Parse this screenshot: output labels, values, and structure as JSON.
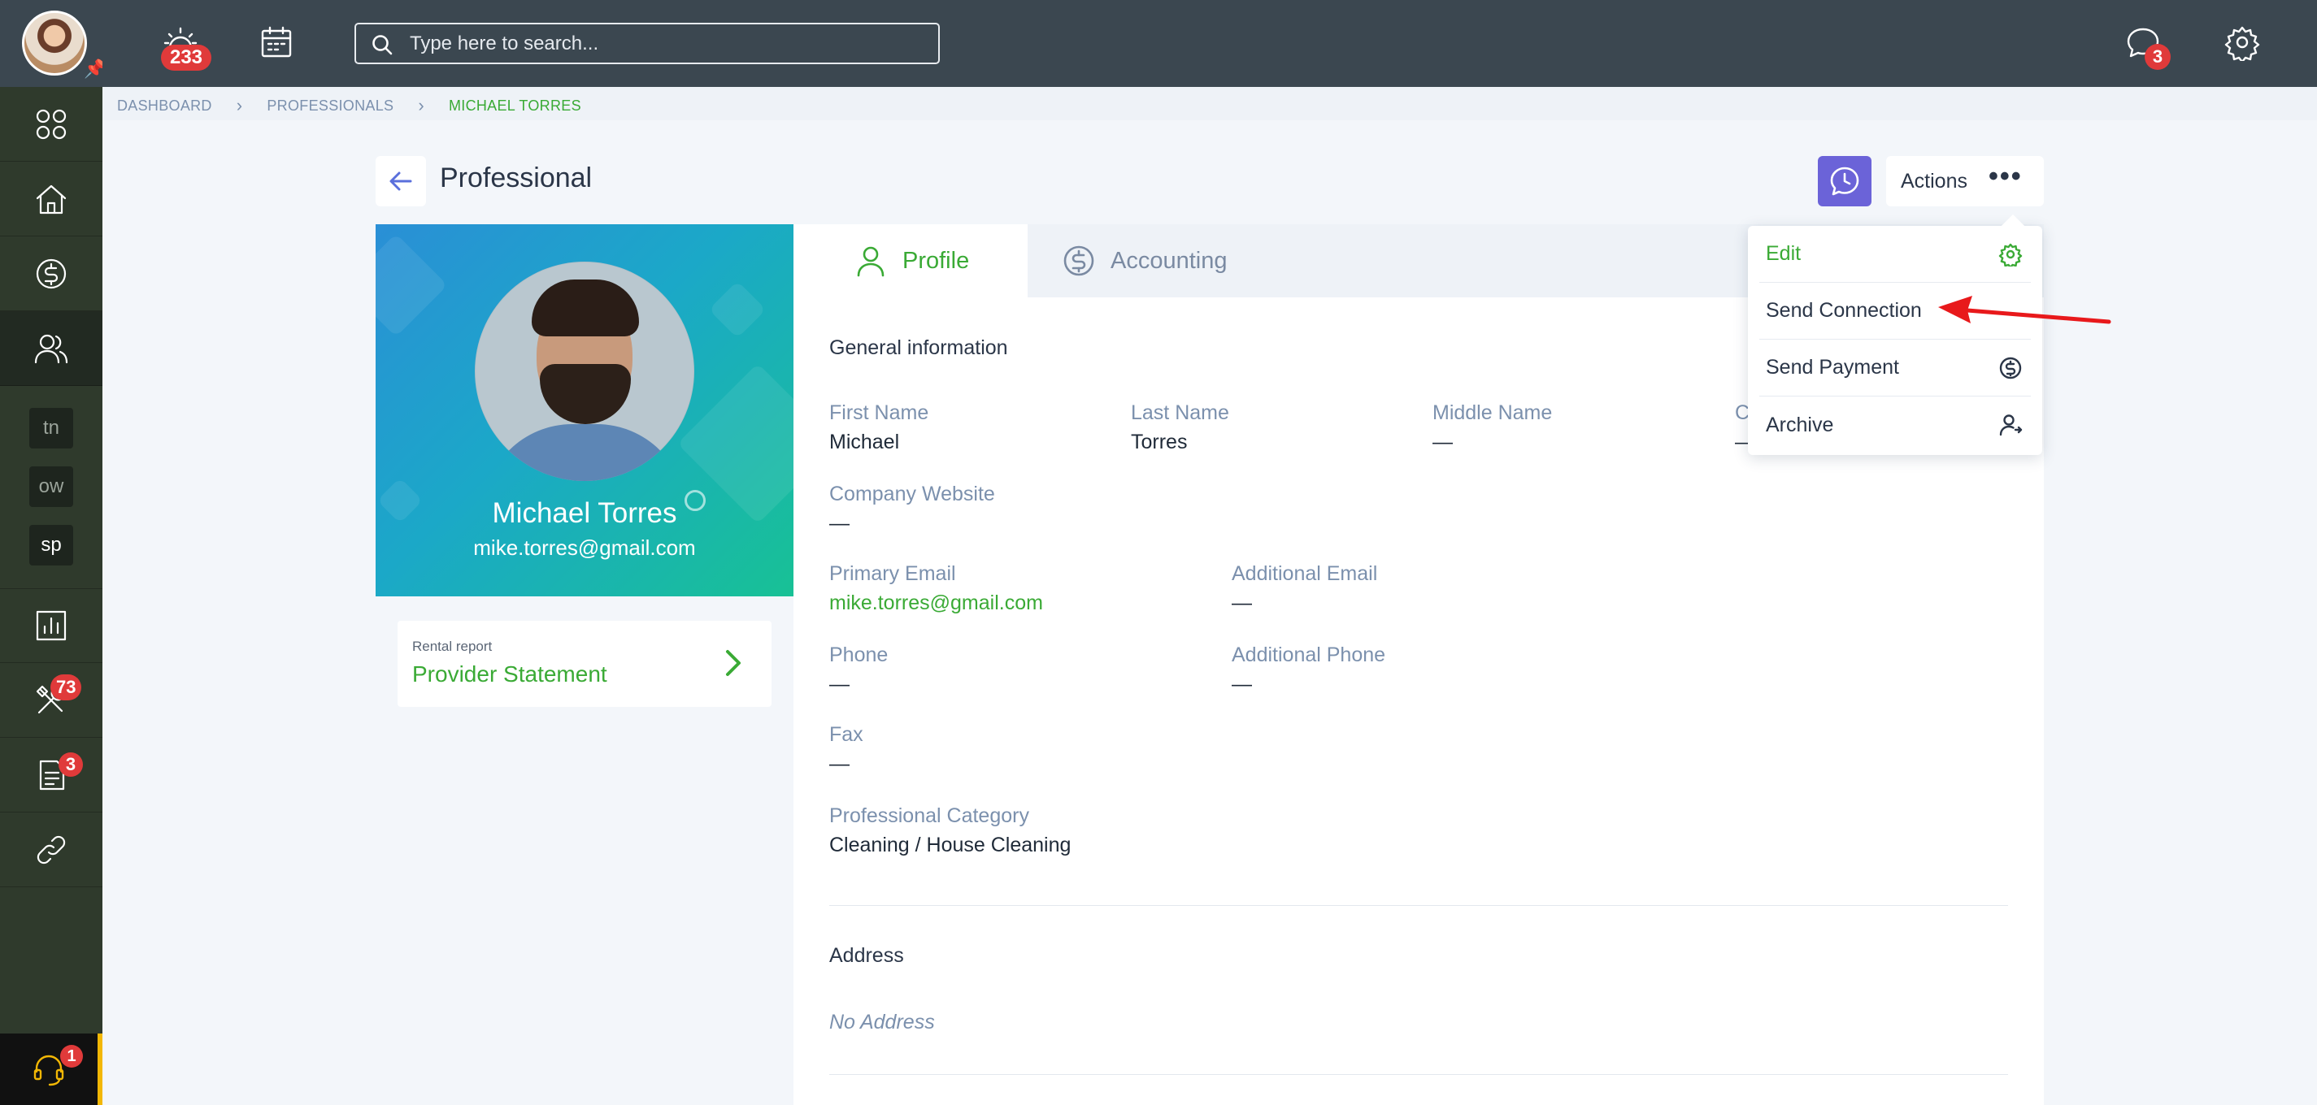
{
  "topbar": {
    "alerts_badge": "233",
    "search_placeholder": "Type here to search...",
    "chat_badge": "3"
  },
  "sidebar": {
    "abbr_items": [
      "tn",
      "ow",
      "sp"
    ],
    "tools_badge": "73",
    "reports_badge": "3",
    "support_badge": "1"
  },
  "breadcrumb": {
    "items": [
      "DASHBOARD",
      "PROFESSIONALS",
      "MICHAEL TORRES"
    ]
  },
  "page": {
    "title": "Professional",
    "actions_label": "Actions"
  },
  "profile": {
    "name": "Michael Torres",
    "email": "mike.torres@gmail.com",
    "report_small": "Rental report",
    "report_big": "Provider Statement"
  },
  "tabs": [
    {
      "label": "Profile"
    },
    {
      "label": "Accounting"
    }
  ],
  "general": {
    "title": "General information",
    "first_name_label": "First Name",
    "first_name": "Michael",
    "last_name_label": "Last Name",
    "last_name": "Torres",
    "middle_name_label": "Middle Name",
    "middle_name": "—",
    "fourth_label": "C",
    "fourth_value": "—",
    "website_label": "Company Website",
    "website": "—",
    "primary_email_label": "Primary Email",
    "primary_email": "mike.torres@gmail.com",
    "additional_email_label": "Additional Email",
    "additional_email": "—",
    "phone_label": "Phone",
    "phone": "—",
    "additional_phone_label": "Additional Phone",
    "additional_phone": "—",
    "fax_label": "Fax",
    "fax": "—",
    "category_label": "Professional Category",
    "category": "Cleaning / House Cleaning"
  },
  "address": {
    "title": "Address",
    "value": "No Address"
  },
  "dropdown": {
    "items": [
      {
        "label": "Edit",
        "icon": "gear-icon"
      },
      {
        "label": "Send Connection",
        "icon": ""
      },
      {
        "label": "Send Payment",
        "icon": "dollar-circle-icon"
      },
      {
        "label": "Archive",
        "icon": "user-archive-icon"
      }
    ]
  },
  "colors": {
    "accent_green": "#3aaa35",
    "topbar": "#3b4750",
    "sidebar": "#2f3a2c",
    "history_button": "#6b63d8",
    "badge_red": "#e03a3a",
    "annotation_red": "#e8191b"
  }
}
